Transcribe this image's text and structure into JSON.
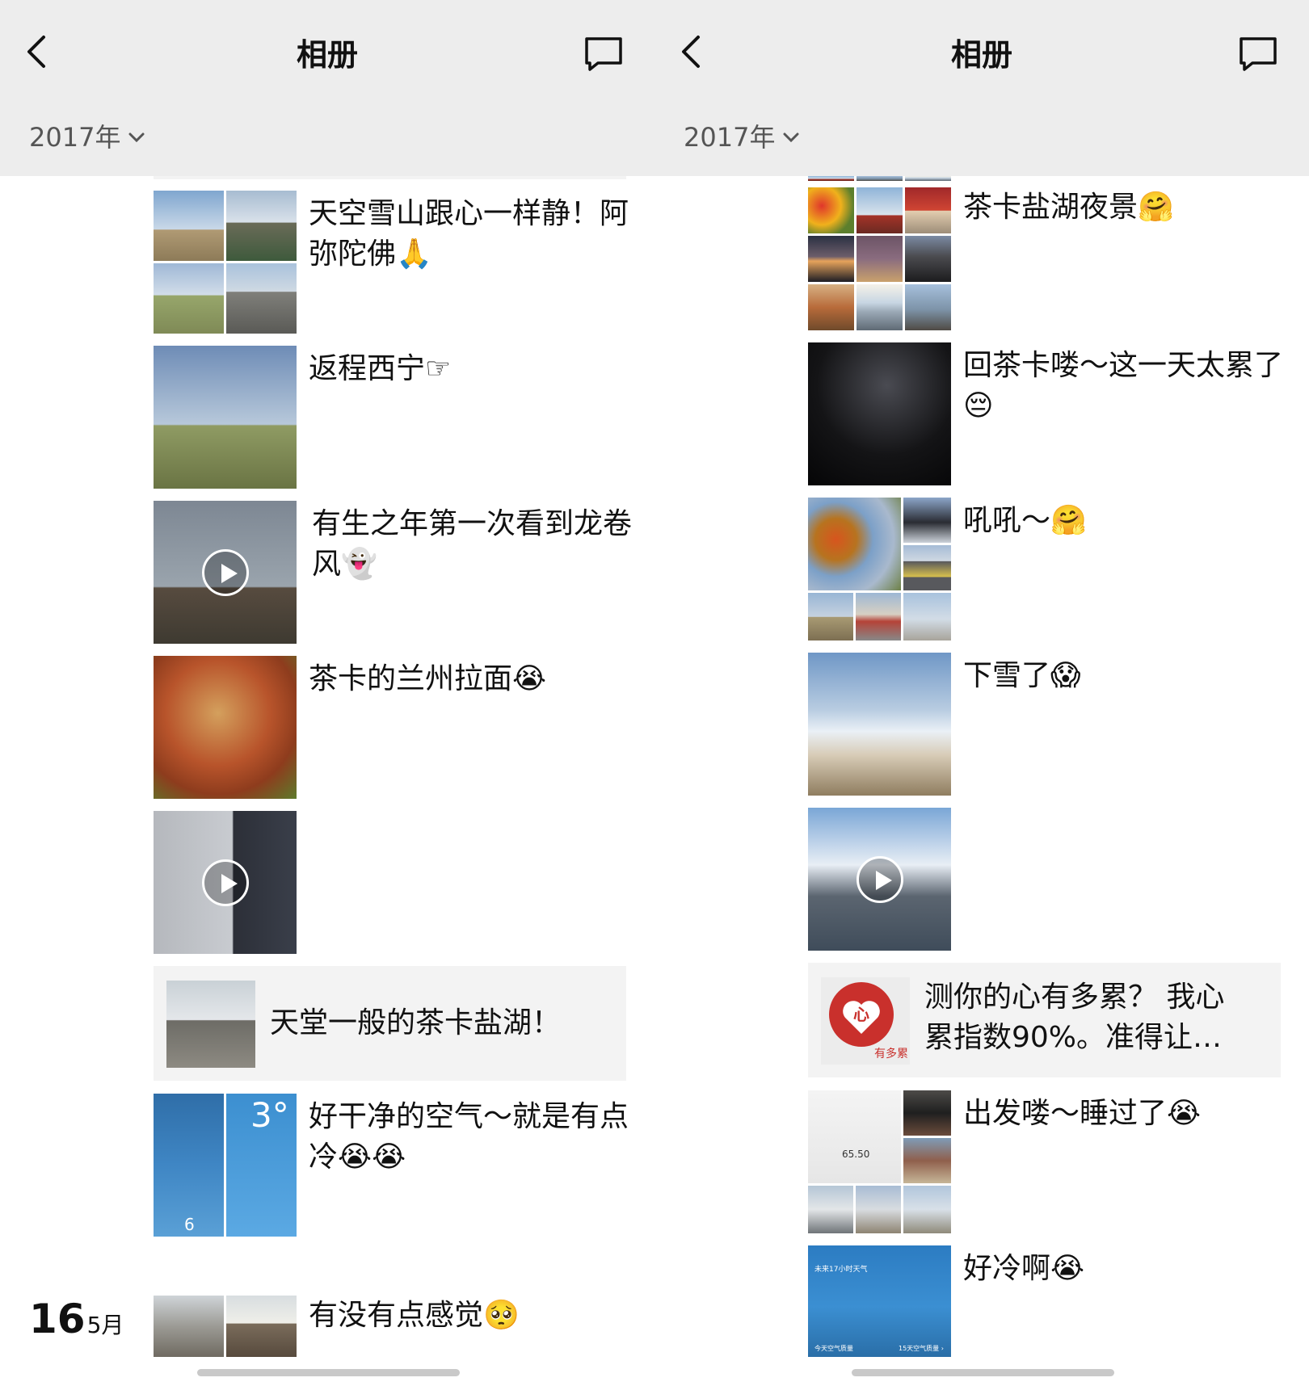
{
  "left": {
    "title": "相册",
    "year": "2017年",
    "posts": [
      {
        "caption": "天空雪山跟心一样静！阿弥陀佛🙏"
      },
      {
        "caption": "返程西宁☞"
      },
      {
        "caption": "有生之年第一次看到龙卷风👻"
      },
      {
        "caption": "茶卡的兰州拉面😭"
      },
      {
        "caption": ""
      },
      {
        "caption": "天堂一般的茶卡盐湖！"
      },
      {
        "caption": "好干净的空气～就是有点冷😭😭"
      },
      {
        "caption": "有没有点感觉🥺"
      }
    ],
    "weather_temp": "3°",
    "weather_small": "6",
    "date_day": "16",
    "date_month": "5月"
  },
  "right": {
    "title": "相册",
    "year": "2017年",
    "posts": [
      {
        "caption": "茶卡盐湖夜景🤗"
      },
      {
        "caption": "回茶卡喽～这一天太累了😔"
      },
      {
        "caption": "吼吼～🤗"
      },
      {
        "caption": "下雪了😱"
      },
      {
        "caption": ""
      },
      {
        "caption": "测你的心有多累？ 我心累指数90%。准得让…"
      },
      {
        "caption": "出发喽～睡过了😭"
      },
      {
        "caption": "好冷啊😭"
      }
    ],
    "heart_char": "心",
    "heart_brand": "有多累",
    "receipt_amount": "65.50",
    "weather_panel_title": "未来17小时天气",
    "weather_panel_footer_left": "今天空气质量",
    "weather_panel_footer_right": "15天空气质量 ›"
  }
}
